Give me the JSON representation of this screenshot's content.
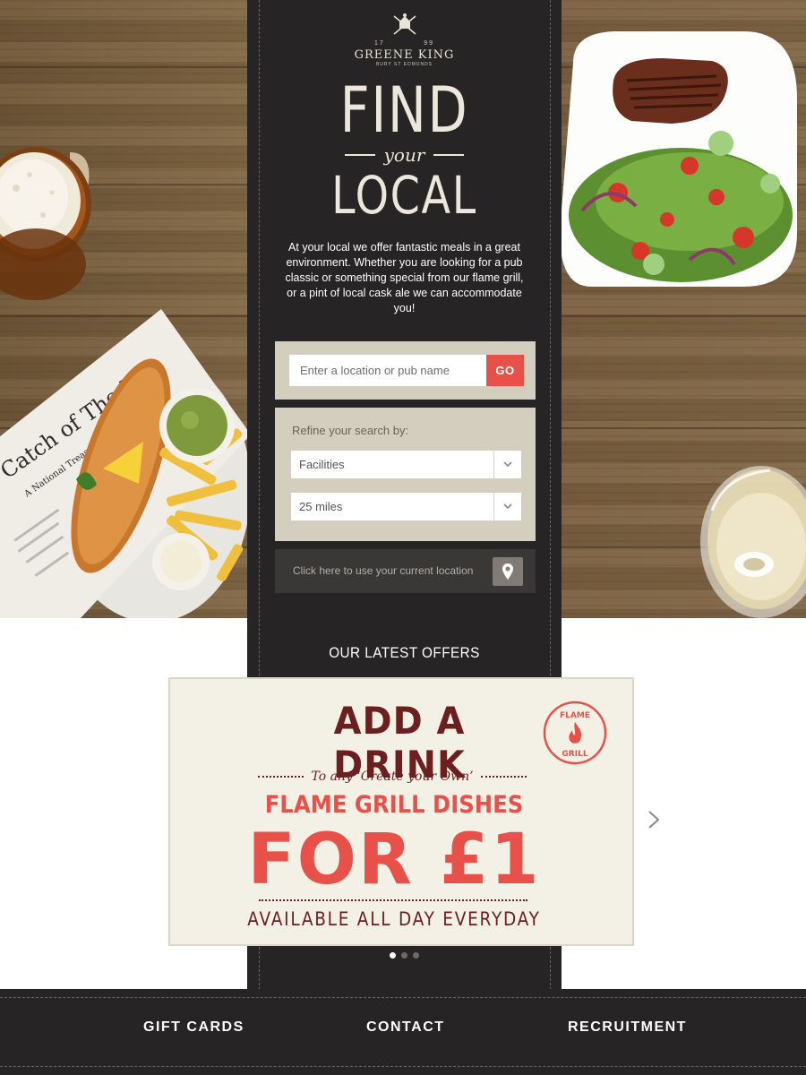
{
  "logo": {
    "year_left": "17",
    "year_right": "99",
    "name": "GREENE KING",
    "subtitle": "BURY ST EDMUNDS"
  },
  "hero": {
    "line1": "FIND",
    "line2": "your",
    "line3": "LOCAL"
  },
  "intro_text": "At your local we offer fantastic meals in a great environment. Whether you are looking for a pub classic or something special from our flame grill, or a pint of local cask ale we can accommodate you!",
  "search": {
    "placeholder": "Enter a location or pub name",
    "button_label": "GO"
  },
  "refine": {
    "title": "Refine your search by:",
    "facilities_value": "Facilities",
    "distance_value": "25 miles"
  },
  "location": {
    "label": "Click here to use your current location",
    "icon": "map-pin-icon"
  },
  "offers": {
    "title": "OUR LATEST OFFERS",
    "slide": {
      "headline": "ADD A DRINK",
      "subline": "To any ‘Create your Own’",
      "dishes": "FLAME GRILL DISHES",
      "price": "FOR £1",
      "availability": "AVAILABLE ALL DAY EVERYDAY",
      "badge_top": "FLAME",
      "badge_bottom": "GRILL"
    },
    "slide_count": 3,
    "active_slide": 1
  },
  "newspaper": {
    "headline": "Catch of The Day",
    "subline": "A National Treasure"
  },
  "footer": {
    "links": [
      "GIFT CARDS",
      "CONTACT",
      "RECRUITMENT"
    ]
  },
  "colors": {
    "dark": "#262424",
    "accent": "#e8514a",
    "panel": "#d4cebe",
    "offer_text": "#6b1f1f"
  }
}
